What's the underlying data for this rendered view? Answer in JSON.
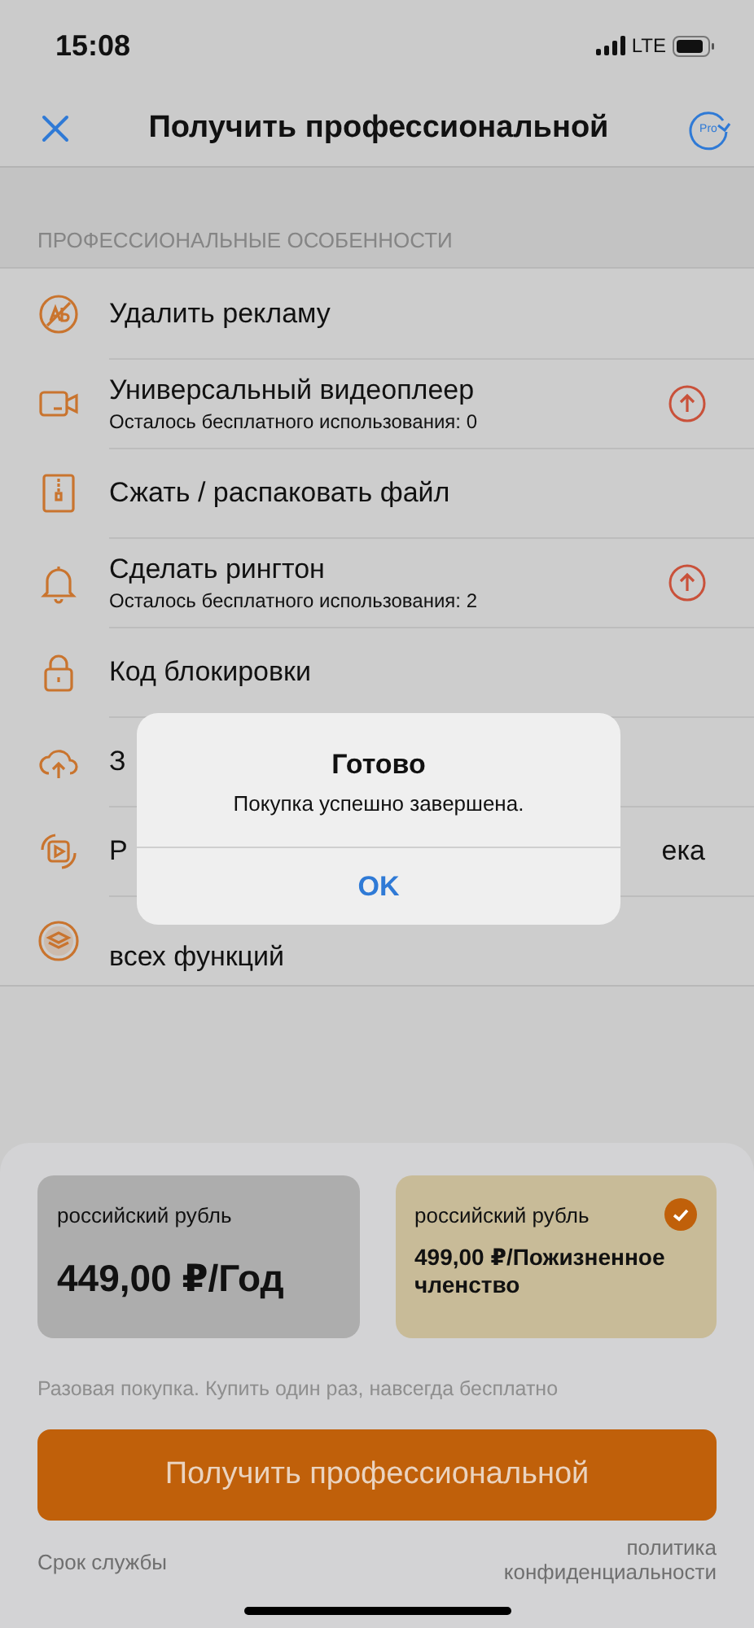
{
  "status_bar": {
    "time": "15:08",
    "network": "LTE"
  },
  "nav": {
    "title": "Получить профессиональной",
    "restore_badge": "Pro"
  },
  "section_header": "ПРОФЕССИОНАЛЬНЫЕ ОСОБЕННОСТИ",
  "features": [
    {
      "title": "Удалить рекламу",
      "upgrade": false
    },
    {
      "title": "Универсальный видеоплеер",
      "subtitle": "Осталось бесплатного использования: 0",
      "upgrade": true
    },
    {
      "title": "Сжать / распаковать файл",
      "upgrade": false
    },
    {
      "title": "Сделать рингтон",
      "subtitle": "Осталось бесплатного использования: 2",
      "upgrade": true
    },
    {
      "title": "Код блокировки",
      "upgrade": false
    },
    {
      "title": "З",
      "upgrade": false
    },
    {
      "title": "Р",
      "title_end": "ека",
      "upgrade": false
    },
    {
      "title_line2": "всех функций",
      "upgrade": false
    }
  ],
  "alert": {
    "title": "Готово",
    "message": "Покупка успешно завершена.",
    "button": "OK"
  },
  "plans": [
    {
      "currency": "российский рубль",
      "price": "449,00 ₽/Год",
      "selected": false
    },
    {
      "currency": "российский рубль",
      "price": "499,00 ₽/Пожизненное членство",
      "selected": true
    }
  ],
  "note": "Разовая покупка. Купить один раз, навсегда бесплатно",
  "buy_button": "Получить профессиональной",
  "links": {
    "terms": "Срок службы",
    "privacy": "политика конфиденциальности"
  }
}
